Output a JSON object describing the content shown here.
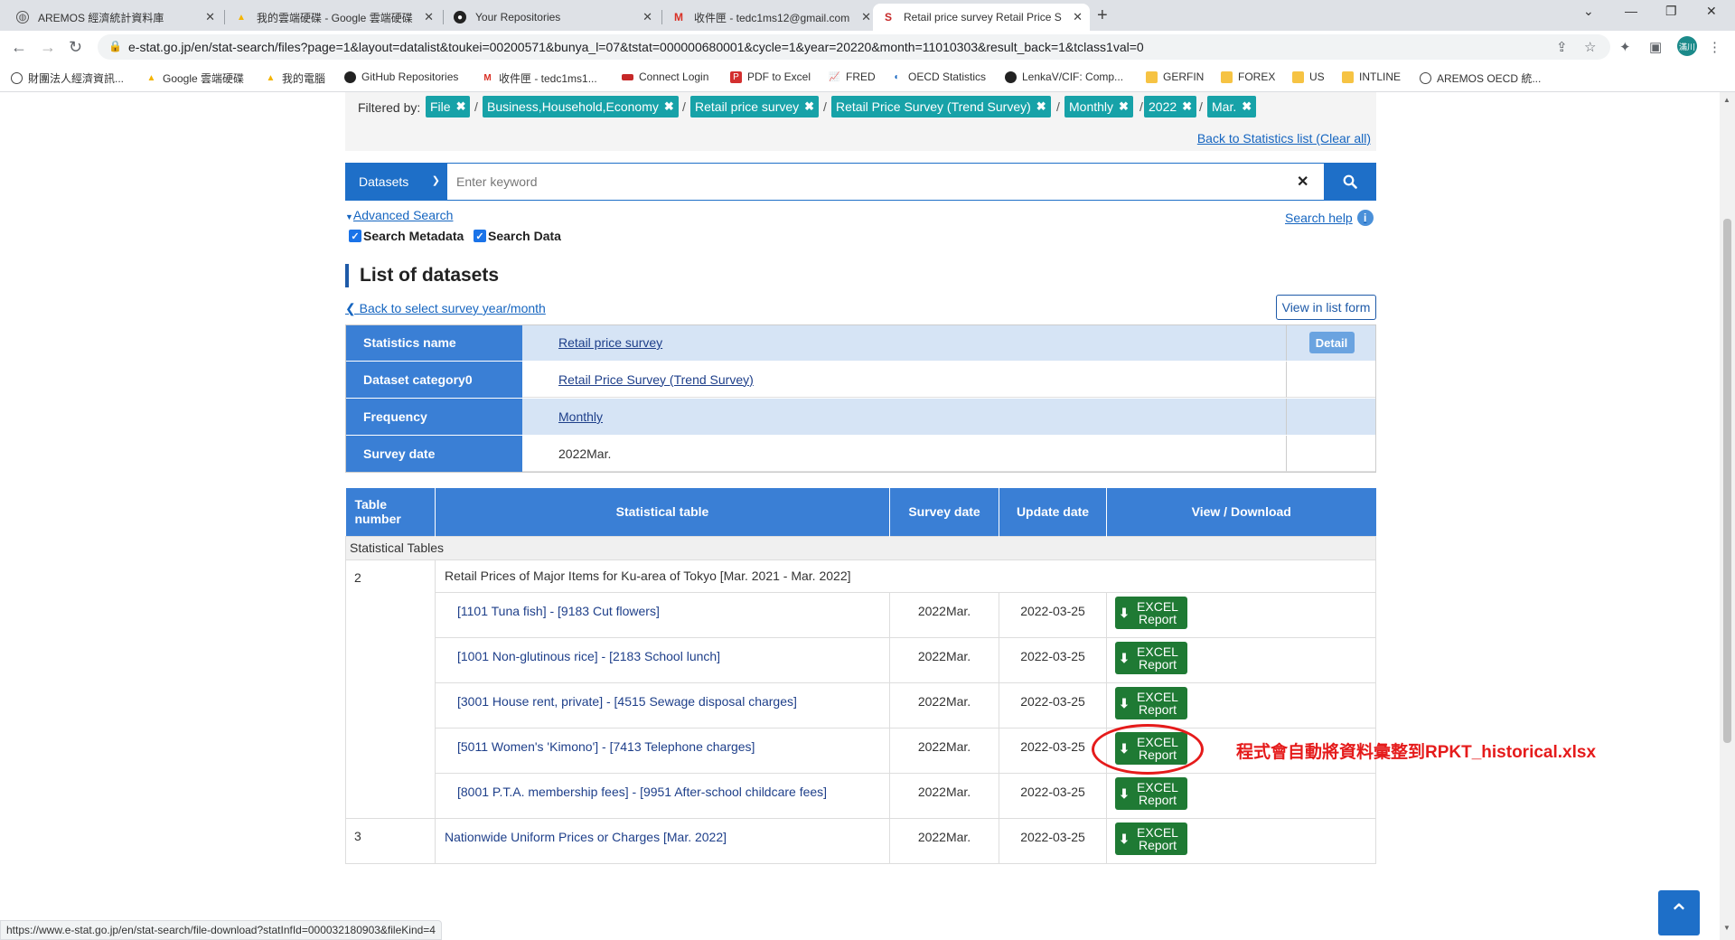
{
  "browser": {
    "tabs": [
      {
        "title": "AREMOS 經濟統計資料庫",
        "icon": "globe-icon"
      },
      {
        "title": "我的雲端硬碟 - Google 雲端硬碟",
        "icon": "google-drive-icon"
      },
      {
        "title": "Your Repositories",
        "icon": "github-icon"
      },
      {
        "title": "收件匣 - tedc1ms12@gmail.com",
        "icon": "gmail-icon"
      },
      {
        "title": "Retail price survey Retail Price S",
        "icon": "estat-icon",
        "active": true
      }
    ],
    "url": "e-stat.go.jp/en/stat-search/files?page=1&layout=datalist&toukei=00200571&bunya_l=07&tstat=000000680001&cycle=1&year=20220&month=11010303&result_back=1&tclass1val=0",
    "profile_label": "滿川",
    "bookmarks": [
      {
        "label": "財團法人經濟資訊...",
        "icon": "globe-icon"
      },
      {
        "label": "Google 雲端硬碟",
        "icon": "google-drive-icon"
      },
      {
        "label": "我的電腦",
        "icon": "google-drive-icon"
      },
      {
        "label": "GitHub Repositories",
        "icon": "github-icon"
      },
      {
        "label": "收件匣 - tedc1ms1...",
        "icon": "gmail-icon"
      },
      {
        "label": "Connect Login",
        "icon": "flag-icon"
      },
      {
        "label": "PDF to Excel",
        "icon": "pdf-icon"
      },
      {
        "label": "FRED",
        "icon": "chart-icon"
      },
      {
        "label": "OECD Statistics",
        "icon": "oecd-icon"
      },
      {
        "label": "LenkaV/CIF: Comp...",
        "icon": "github-icon"
      },
      {
        "label": "GERFIN",
        "icon": "folder-icon"
      },
      {
        "label": "FOREX",
        "icon": "folder-icon"
      },
      {
        "label": "US",
        "icon": "folder-icon"
      },
      {
        "label": "INTLINE",
        "icon": "folder-icon"
      },
      {
        "label": "AREMOS OECD 統...",
        "icon": "globe-icon"
      }
    ]
  },
  "filters": {
    "label": "Filtered by:",
    "chips": [
      "File",
      "Business,Household,Economy",
      "Retail price survey",
      "Retail Price Survey (Trend Survey)",
      "Monthly",
      "2022",
      "Mar."
    ],
    "clear_link": "Back to Statistics list (Clear all)"
  },
  "search": {
    "scope": "Datasets",
    "placeholder": "Enter keyword",
    "advanced": "Advanced Search",
    "help": "Search help",
    "check_metadata": "Search Metadata",
    "check_data": "Search Data"
  },
  "list": {
    "title": "List of datasets",
    "back_link": "Back to select survey year/month",
    "view_list_form": "View in list form"
  },
  "info_rows": [
    {
      "label": "Statistics name",
      "value": "Retail price survey",
      "link": true,
      "action": "Detail"
    },
    {
      "label": "Dataset category0",
      "value": "Retail Price Survey (Trend Survey)",
      "link": true,
      "action": ""
    },
    {
      "label": "Frequency",
      "value": "Monthly",
      "link": true,
      "action": ""
    },
    {
      "label": "Survey date",
      "value": "2022Mar.",
      "link": false,
      "action": ""
    }
  ],
  "table": {
    "headers": {
      "num": "Table number",
      "stat": "Statistical table",
      "survey": "Survey date",
      "update": "Update date",
      "view": "View / Download"
    },
    "group": "Statistical Tables",
    "table2": {
      "number": "2",
      "title": "Retail Prices of Major Items for Ku-area of Tokyo [Mar. 2021 - Mar. 2022]",
      "rows": [
        {
          "name": "[1101 Tuna fish] - [9183 Cut flowers]",
          "survey": "2022Mar.",
          "update": "2022-03-25"
        },
        {
          "name": "[1001 Non-glutinous rice] - [2183 School lunch]",
          "survey": "2022Mar.",
          "update": "2022-03-25"
        },
        {
          "name": "[3001 House rent, private] - [4515 Sewage disposal charges]",
          "survey": "2022Mar.",
          "update": "2022-03-25"
        },
        {
          "name": "[5011 Women's 'Kimono'] - [7413 Telephone charges]",
          "survey": "2022Mar.",
          "update": "2022-03-25"
        },
        {
          "name": "[8001 P.T.A. membership fees] - [9951 After-school childcare fees]",
          "survey": "2022Mar.",
          "update": "2022-03-25"
        }
      ]
    },
    "table3": {
      "number": "3",
      "title": "Nationwide Uniform Prices or Charges [Mar. 2022]",
      "survey": "2022Mar.",
      "update": "2022-03-25"
    },
    "excel_line1": "EXCEL",
    "excel_line2": "Report"
  },
  "annotation": "程式會自動將資料彙整到RPKT_historical.xlsx",
  "status_url": "https://www.e-stat.go.jp/en/stat-search/file-download?statInfId=000032180903&fileKind=4",
  "colors": {
    "primary": "#1e6fc8",
    "chip": "#17a2a8",
    "excel": "#1f7a34",
    "annotation": "#e51b1b"
  }
}
